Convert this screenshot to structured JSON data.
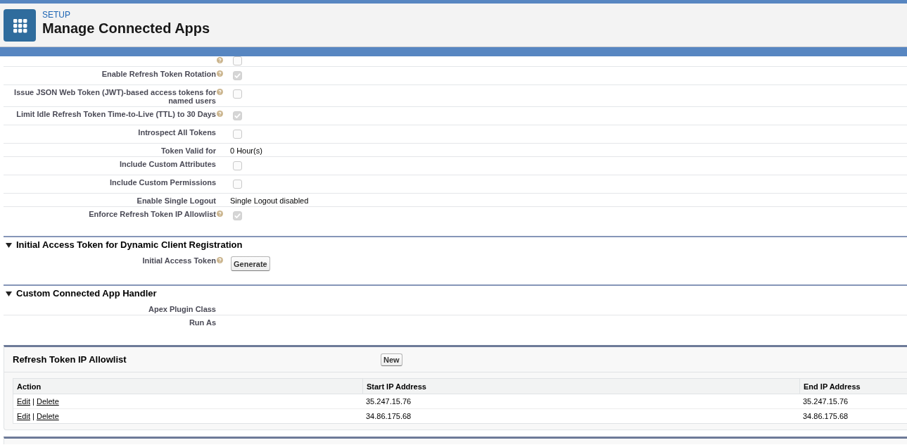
{
  "header": {
    "eyebrow": "SETUP",
    "title": "Manage Connected Apps"
  },
  "detail_rows": [
    {
      "kind": "checkbox",
      "checked": false,
      "disabled": true,
      "help": true
    },
    {
      "label": "Enable Refresh Token Rotation",
      "help": true,
      "kind": "checkbox",
      "checked": true,
      "disabled": true
    },
    {
      "label": "Issue JSON Web Token (JWT)-based access tokens for named users",
      "help": true,
      "kind": "checkbox",
      "checked": false,
      "disabled": true
    },
    {
      "label": "Limit Idle Refresh Token Time-to-Live (TTL) to 30 Days",
      "help": true,
      "kind": "checkbox",
      "checked": true,
      "disabled": true
    },
    {
      "label": "Introspect All Tokens",
      "help": false,
      "kind": "checkbox",
      "checked": false,
      "disabled": true
    },
    {
      "label": "Token Valid for",
      "help": false,
      "kind": "text",
      "value": "0 Hour(s)"
    },
    {
      "label": "Include Custom Attributes",
      "help": false,
      "kind": "checkbox",
      "checked": false,
      "disabled": true
    },
    {
      "label": "Include Custom Permissions",
      "help": false,
      "kind": "checkbox",
      "checked": false,
      "disabled": true
    },
    {
      "label": "Enable Single Logout",
      "help": false,
      "kind": "text",
      "value": "Single Logout disabled"
    },
    {
      "label": "Enforce Refresh Token IP Allowlist",
      "help": true,
      "kind": "checkbox",
      "checked": true,
      "disabled": true
    }
  ],
  "sections": [
    {
      "title": "Initial Access Token for Dynamic Client Registration",
      "expanded": true,
      "rows": [
        {
          "label": "Initial Access Token",
          "help": true,
          "kind": "button",
          "button": "Generate"
        }
      ]
    },
    {
      "title": "Custom Connected App Handler",
      "expanded": true,
      "rows": [
        {
          "label": "Apex Plugin Class",
          "help": false,
          "kind": "empty"
        },
        {
          "label": "Run As",
          "help": false,
          "kind": "empty"
        }
      ]
    }
  ],
  "related_list": {
    "title": "Refresh Token IP Allowlist",
    "button": "New",
    "columns": [
      "Action",
      "Start IP Address",
      "End IP Address"
    ],
    "rows": [
      {
        "cells": [
          {
            "links": [
              "Edit",
              "Delete"
            ],
            "separator": "|"
          },
          "35.247.15.76",
          "35.247.15.76"
        ]
      },
      {
        "cells": [
          {
            "links": [
              "Edit",
              "Delete"
            ],
            "separator": "|"
          },
          "34.86.175.68",
          "34.86.175.68"
        ]
      }
    ]
  }
}
